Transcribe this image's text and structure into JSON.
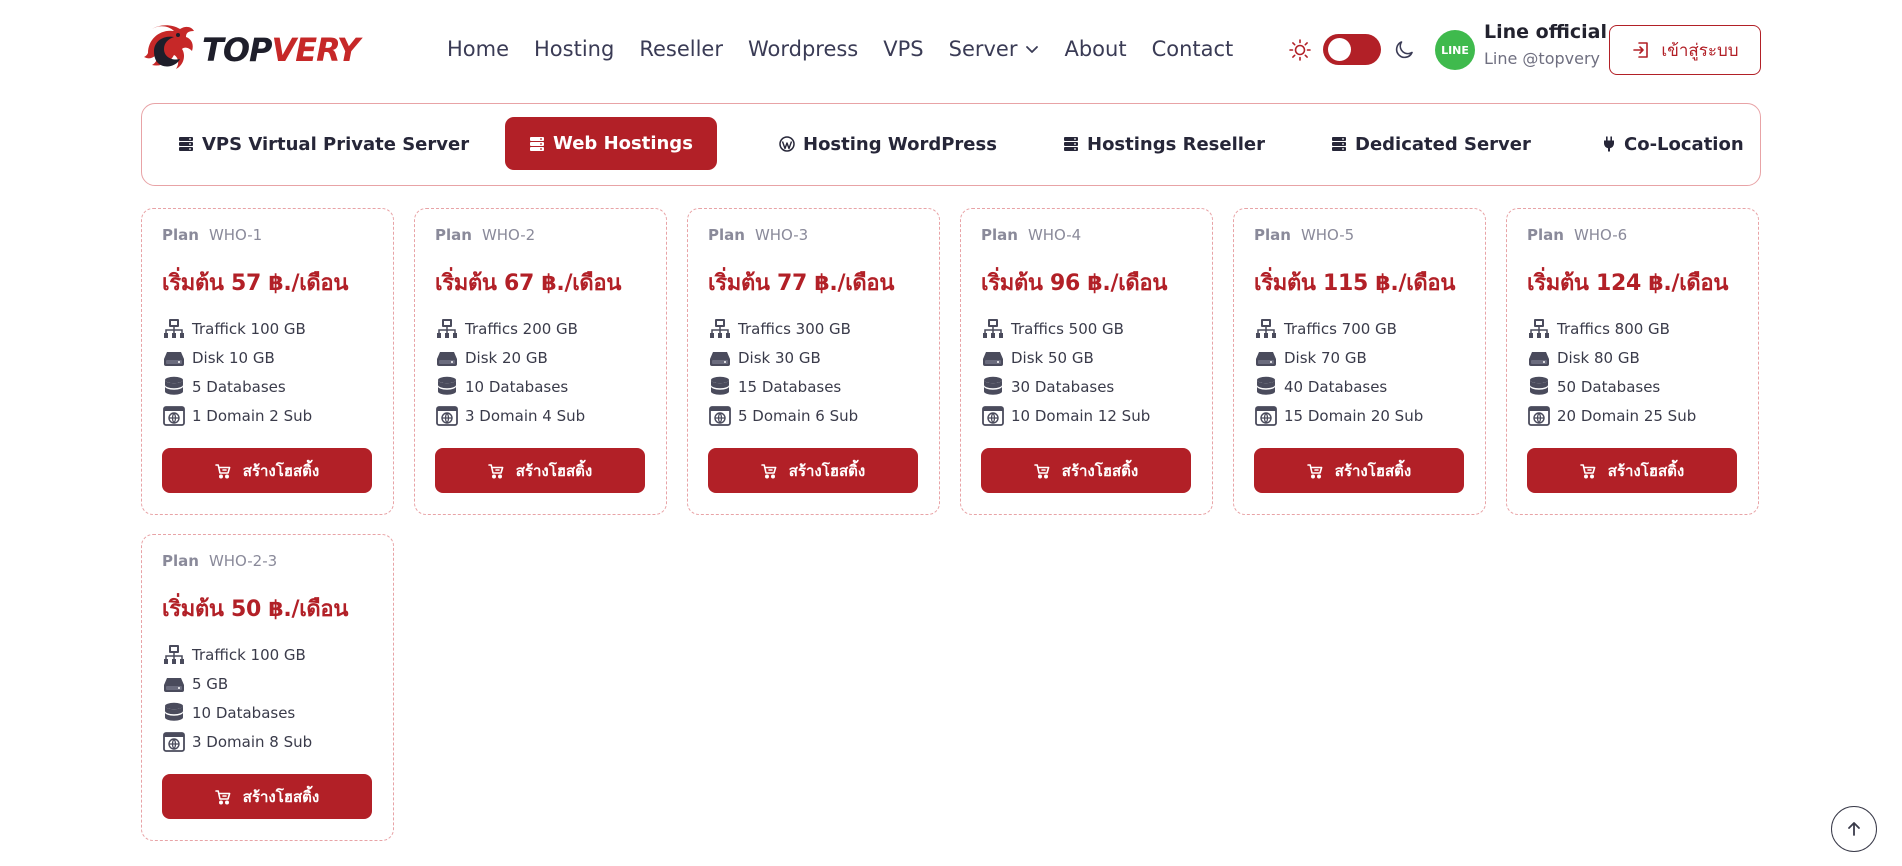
{
  "brand": {
    "logo_top": "TOP",
    "logo_very": "VERY"
  },
  "nav": [
    {
      "label": "Home"
    },
    {
      "label": "Hosting"
    },
    {
      "label": "Reseller"
    },
    {
      "label": "Wordpress"
    },
    {
      "label": "VPS"
    },
    {
      "label": "Server"
    },
    {
      "label": "About"
    },
    {
      "label": "Contact"
    }
  ],
  "theme_toggle": {
    "mode": "light",
    "icons": [
      "sun-icon",
      "moon-icon"
    ]
  },
  "line": {
    "badge": "LINE",
    "title": "Line official",
    "handle": "Line @topvery"
  },
  "login_label": "เข้าสู่ระบบ",
  "tabs": [
    {
      "label": "VPS Virtual Private Server",
      "icon": "server-icon",
      "active": false
    },
    {
      "label": "Web Hostings",
      "icon": "server-icon",
      "active": true
    },
    {
      "label": "Hosting WordPress",
      "icon": "wordpress-icon",
      "active": false
    },
    {
      "label": "Hostings Reseller",
      "icon": "server-icon",
      "active": false
    },
    {
      "label": "Dedicated Server",
      "icon": "server-icon",
      "active": false
    },
    {
      "label": "Co-Location",
      "icon": "plug-icon",
      "active": false
    }
  ],
  "plan_label": "Plan",
  "buy_label": "สร้างโฮสติ้ง",
  "plans": [
    {
      "code": "WHO-1",
      "price": "เริ่มต้น 57 ฿./เดือน",
      "traffic": "Traffick 100 GB",
      "disk": "Disk 10 GB",
      "databases": "5 Databases",
      "domains": "1 Domain 2 Sub"
    },
    {
      "code": "WHO-2",
      "price": "เริ่มต้น 67 ฿./เดือน",
      "traffic": "Traffics 200 GB",
      "disk": "Disk 20 GB",
      "databases": "10 Databases",
      "domains": "3 Domain 4 Sub"
    },
    {
      "code": "WHO-3",
      "price": "เริ่มต้น 77 ฿./เดือน",
      "traffic": "Traffics 300 GB",
      "disk": "Disk 30 GB",
      "databases": "15 Databases",
      "domains": "5 Domain 6 Sub"
    },
    {
      "code": "WHO-4",
      "price": "เริ่มต้น 96 ฿./เดือน",
      "traffic": "Traffics 500 GB",
      "disk": "Disk 50 GB",
      "databases": "30 Databases",
      "domains": "10 Domain 12 Sub"
    },
    {
      "code": "WHO-5",
      "price": "เริ่มต้น 115 ฿./เดือน",
      "traffic": "Traffics 700 GB",
      "disk": "Disk 70 GB",
      "databases": "40 Databases",
      "domains": "15 Domain 20 Sub"
    },
    {
      "code": "WHO-6",
      "price": "เริ่มต้น 124 ฿./เดือน",
      "traffic": "Traffics 800 GB",
      "disk": "Disk 80 GB",
      "databases": "50 Databases",
      "domains": "20 Domain 25 Sub"
    },
    {
      "code": "WHO-2-3",
      "price": "เริ่มต้น 50 ฿./เดือน",
      "traffic": "Traffick 100 GB",
      "disk": "5 GB",
      "databases": "10 Databases",
      "domains": "3 Domain 8 Sub"
    }
  ],
  "colors": {
    "accent": "#b22027",
    "card_border": "#e8a3a6",
    "line_green": "#3fba4d",
    "text_dark": "#3a3b55"
  }
}
